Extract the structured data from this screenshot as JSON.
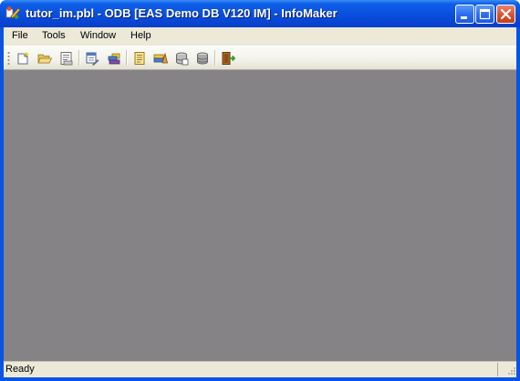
{
  "window": {
    "title": "tutor_im.pbl - ODB [EAS Demo DB V120 IM]  - InfoMaker"
  },
  "title_buttons": [
    "minimize-icon",
    "maximize-icon",
    "close-icon"
  ],
  "menu": {
    "items": [
      {
        "label": "File"
      },
      {
        "label": "Tools"
      },
      {
        "label": "Window"
      },
      {
        "label": "Help"
      }
    ]
  },
  "toolbar": {
    "icons": [
      "new-icon",
      "open-folder-icon",
      "print-preview-icon",
      "report-painter-icon",
      "library-icon",
      "script-icon",
      "query-icon",
      "database-painter-icon",
      "database-icon",
      "exit-door-icon"
    ]
  },
  "status": {
    "text": "Ready"
  },
  "colors": {
    "titlebar": "#0a52df",
    "workspace": "#858385",
    "chrome": "#ece9d8"
  }
}
